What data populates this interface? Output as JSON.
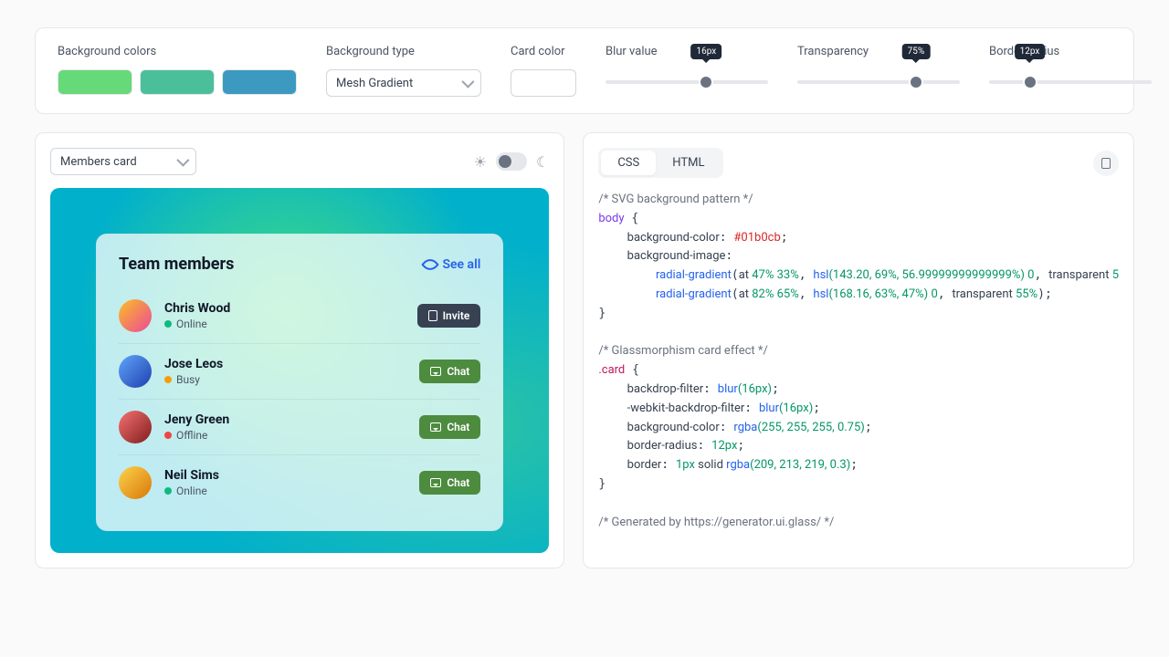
{
  "toolbar": {
    "bgcolors": {
      "label": "Background colors",
      "swatches": [
        "#66d978",
        "#4bbf9a",
        "#3c9ac0"
      ]
    },
    "bgtype": {
      "label": "Background type",
      "value": "Mesh Gradient"
    },
    "cardcolor": {
      "label": "Card color"
    },
    "blur": {
      "label": "Blur value",
      "tip": "16px",
      "pct": 62
    },
    "transparency": {
      "label": "Transparency",
      "tip": "75%",
      "pct": 73
    },
    "radius": {
      "label": "Border radius",
      "tip": "12px",
      "pct": 25
    }
  },
  "preview": {
    "select": "Members card",
    "card": {
      "title": "Team members",
      "see_all": "See all",
      "invite": "Invite",
      "chat": "Chat",
      "members": [
        {
          "name": "Chris Wood",
          "status": "Online",
          "dot": "online",
          "btn": "invite",
          "av": ""
        },
        {
          "name": "Jose Leos",
          "status": "Busy",
          "dot": "busy",
          "btn": "chat",
          "av": "av2"
        },
        {
          "name": "Jeny Green",
          "status": "Offline",
          "dot": "offline",
          "btn": "chat",
          "av": "av3"
        },
        {
          "name": "Neil Sims",
          "status": "Online",
          "dot": "online",
          "btn": "chat",
          "av": "av4"
        }
      ]
    }
  },
  "code": {
    "tabs": {
      "css": "CSS",
      "html": "HTML"
    },
    "lines": {
      "c1": "/* SVG background pattern */",
      "sel_body": "body",
      "bg_color_prop": "background-color",
      "bg_color_val": "#01b0cb",
      "bg_img_prop": "background-image",
      "rg": "radial-gradient",
      "at": "at ",
      "g1_pos": "47% 33%",
      "hsl": "hsl",
      "g1_hsl": "(143.20, 69%, 56.99999999999999%)",
      "g1_stop": " 0",
      "g1_end": "transparent ",
      "g1_end2": "5",
      "g2_pos": "82% 65%",
      "g2_hsl": "(168.16, 63%, 47%)",
      "g2_stop": " 0",
      "g2_end": "transparent ",
      "g2_end2": "55%",
      "c2": "/* Glassmorphism card effect */",
      "sel_card": ".card",
      "bf_prop": "backdrop-filter",
      "blur_fn": "blur",
      "blur_arg": "(16px)",
      "wbf_prop": "-webkit-backdrop-filter",
      "blur_arg2": "(16px)",
      "bgc_prop": "background-color",
      "rgba": "rgba",
      "rgba_arg": "(255, 255, 255, 0.75)",
      "br_prop": "border-radius",
      "br_val": "12px",
      "bd_prop": "border",
      "bd_val1": "1px",
      "bd_val2": " solid ",
      "rgba2_arg": "(209, 213, 219, 0.3)",
      "c3": "/* Generated by https://generator.ui.glass/ */"
    }
  }
}
